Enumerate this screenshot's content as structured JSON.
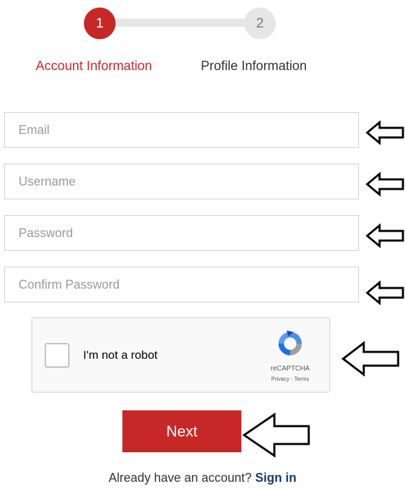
{
  "stepper": {
    "steps": [
      {
        "number": "1",
        "label": "Account Information",
        "active": true
      },
      {
        "number": "2",
        "label": "Profile Information",
        "active": false
      }
    ]
  },
  "form": {
    "email_placeholder": "Email",
    "username_placeholder": "Username",
    "password_placeholder": "Password",
    "confirm_password_placeholder": "Confirm Password"
  },
  "captcha": {
    "label": "I'm not a robot",
    "brand": "reCAPTCHA",
    "links": "Privacy - Terms"
  },
  "next_button": {
    "label": "Next"
  },
  "footer": {
    "prompt": "Already have an account?",
    "signin_label": "Sign in"
  },
  "colors": {
    "accent": "#c62828",
    "link": "#1a3c6e",
    "inactive_step": "#e6e6e6"
  },
  "icons": [
    "arrow-left-icon",
    "recaptcha-logo-icon"
  ]
}
